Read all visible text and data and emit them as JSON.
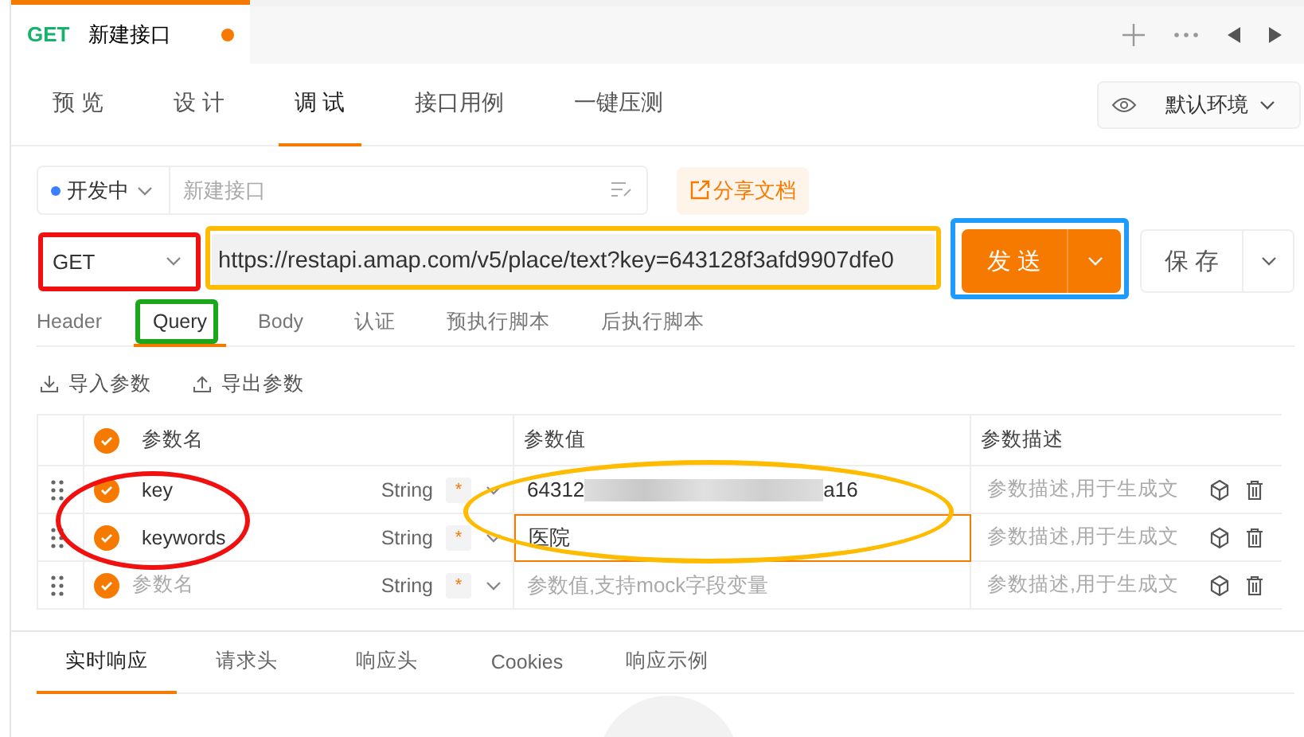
{
  "tab_bar": {
    "tabs": [
      {
        "method": "GET",
        "title": "新建接口",
        "unsaved": true,
        "selected": true
      }
    ]
  },
  "view_tabs": [
    {
      "label": "预 览",
      "selected": false
    },
    {
      "label": "设 计",
      "selected": false
    },
    {
      "label": "调 试",
      "selected": true
    },
    {
      "label": "接口用例",
      "selected": false
    },
    {
      "label": "一键压测",
      "selected": false
    }
  ],
  "environment": {
    "label": "默认环境"
  },
  "status": {
    "label": "开发中",
    "color": "#3d7eff"
  },
  "name_field": {
    "placeholder": "新建接口"
  },
  "share_button": {
    "label": "分享文档"
  },
  "request": {
    "method": "GET",
    "url": "https://restapi.amap.com/v5/place/text?key=643128f3afd9907dfe0",
    "send": "发 送",
    "save": "保 存"
  },
  "request_tabs": [
    {
      "label": "Header",
      "selected": false
    },
    {
      "label": "Query",
      "selected": true
    },
    {
      "label": "Body",
      "selected": false
    },
    {
      "label": "认证",
      "selected": false
    },
    {
      "label": "预执行脚本",
      "selected": false
    },
    {
      "label": "后执行脚本",
      "selected": false
    }
  ],
  "param_actions": [
    "导入参数",
    "导出参数"
  ],
  "table": {
    "columns": [
      "参数名",
      "参数值",
      "参数描述"
    ],
    "header_checked": true,
    "rows": [
      {
        "checked": true,
        "name": {
          "value": "key"
        },
        "type": "String",
        "required": "*",
        "value_segments": [
          {
            "kind": "text",
            "text": "64312"
          },
          {
            "kind": "redacted"
          },
          {
            "kind": "text",
            "text": "a16"
          }
        ],
        "focused": false,
        "description": {
          "placeholder": "参数描述,用于生成文"
        }
      },
      {
        "checked": true,
        "name": {
          "value": "keywords"
        },
        "type": "String",
        "required": "*",
        "value_segments": [
          {
            "kind": "text",
            "text": "医院"
          }
        ],
        "focused": true,
        "description": {
          "placeholder": "参数描述,用于生成文"
        }
      },
      {
        "checked": true,
        "name": {
          "placeholder": "参数名"
        },
        "type": "String",
        "required": "*",
        "value_segments": [
          {
            "kind": "placeholder",
            "text": "参数值,支持mock字段变量"
          }
        ],
        "focused": false,
        "description": {
          "placeholder": "参数描述,用于生成文"
        }
      }
    ]
  },
  "response_tabs": [
    {
      "label": "实时响应",
      "selected": true
    },
    {
      "label": "请求头",
      "selected": false
    },
    {
      "label": "响应头",
      "selected": false
    },
    {
      "label": "Cookies",
      "selected": false
    },
    {
      "label": "响应示例",
      "selected": false
    }
  ],
  "annotations": [
    {
      "kind": "rect",
      "color": "#f01010"
    },
    {
      "kind": "rect",
      "color": "#ffbb00"
    },
    {
      "kind": "rect",
      "color": "#1e9bff"
    },
    {
      "kind": "rect",
      "color": "#1aa81a"
    },
    {
      "kind": "ellipse",
      "color": "#f01010"
    },
    {
      "kind": "ellipse",
      "color": "#ffbb00"
    }
  ]
}
